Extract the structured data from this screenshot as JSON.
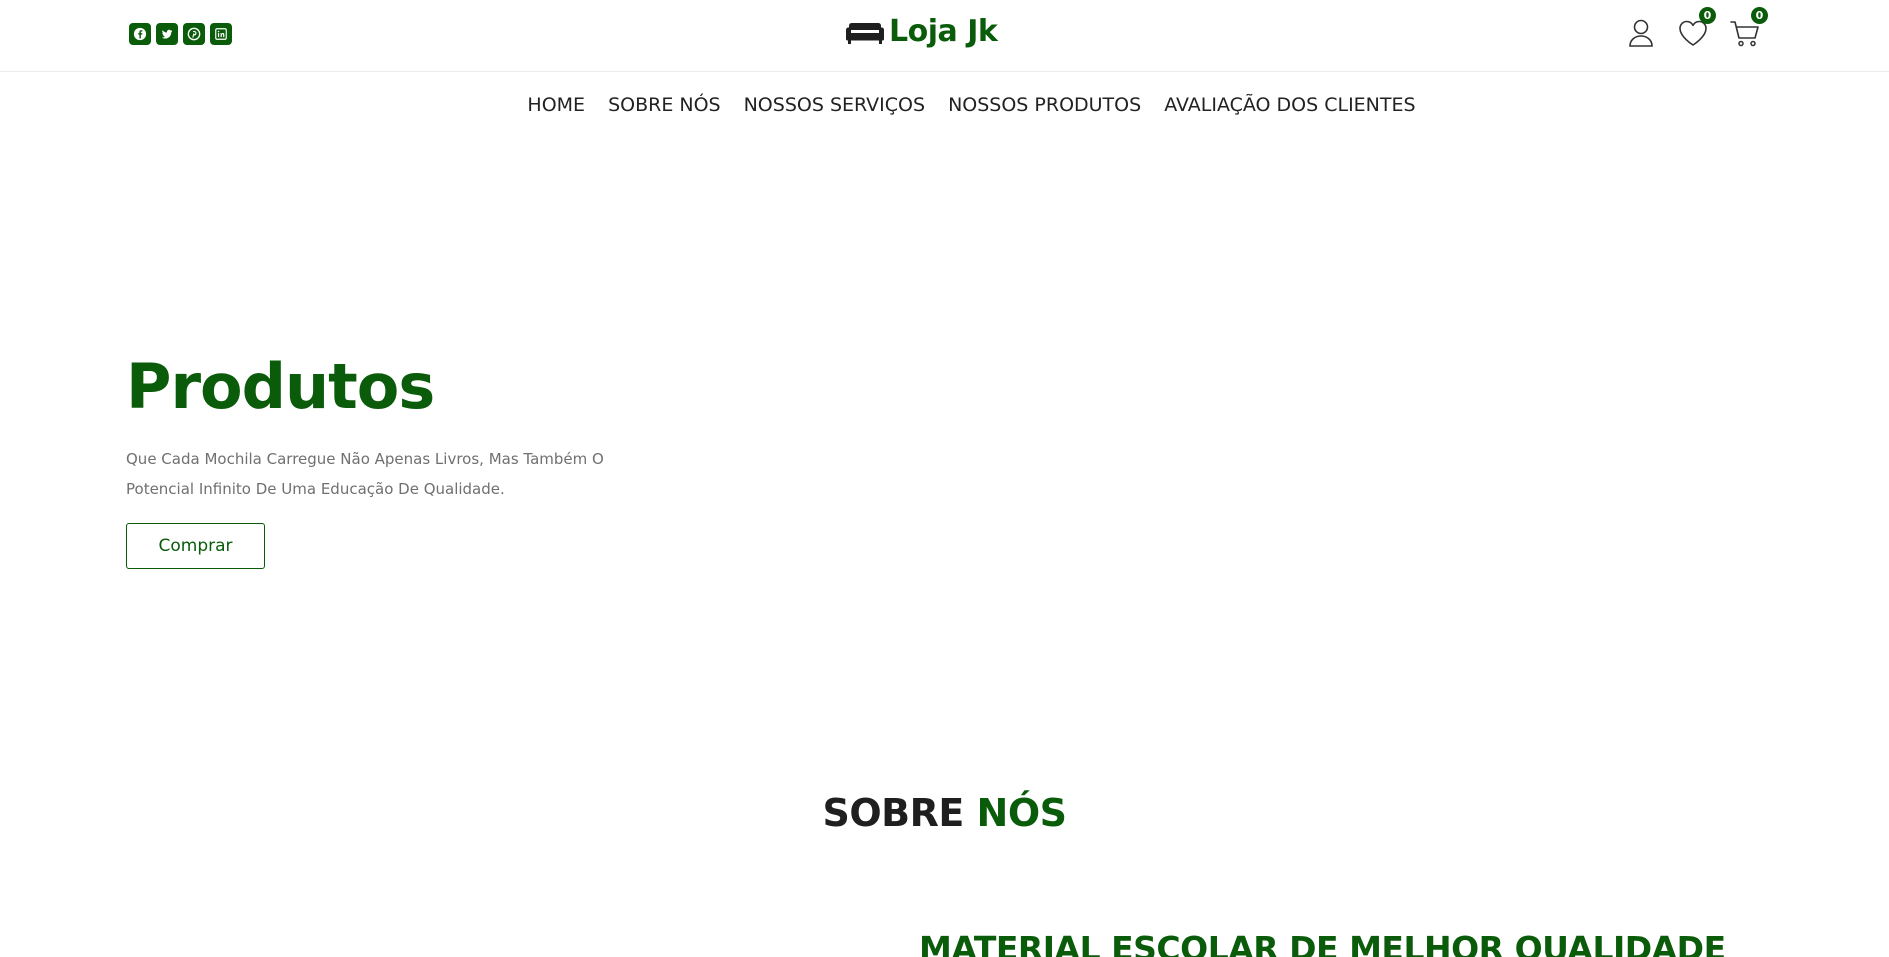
{
  "header": {
    "brand": "Loja Jk",
    "brand_color": "#0a5c0a",
    "socials": [
      {
        "icon": "facebook-icon"
      },
      {
        "icon": "twitter-icon"
      },
      {
        "icon": "pinterest-icon"
      },
      {
        "icon": "linkedin-icon"
      }
    ],
    "wishlist_count": "0",
    "cart_count": "0"
  },
  "nav": {
    "items": [
      "HOME",
      "SOBRE NÓS",
      "NOSSOS SERVIÇOS",
      "NOSSOS PRODUTOS",
      "AVALIAÇÃO DOS CLIENTES"
    ]
  },
  "hero": {
    "title": "Produtos",
    "text": "Que Cada Mochila Carregue Não Apenas Livros, Mas Também O Potencial Infinito De Uma Educação De Qualidade.",
    "button": "Comprar"
  },
  "about": {
    "title_part1": "SOBRE ",
    "title_part2": "NÓS",
    "subtitle": "MATERIAL ESCOLAR DE MELHOR QUALIDADE"
  }
}
